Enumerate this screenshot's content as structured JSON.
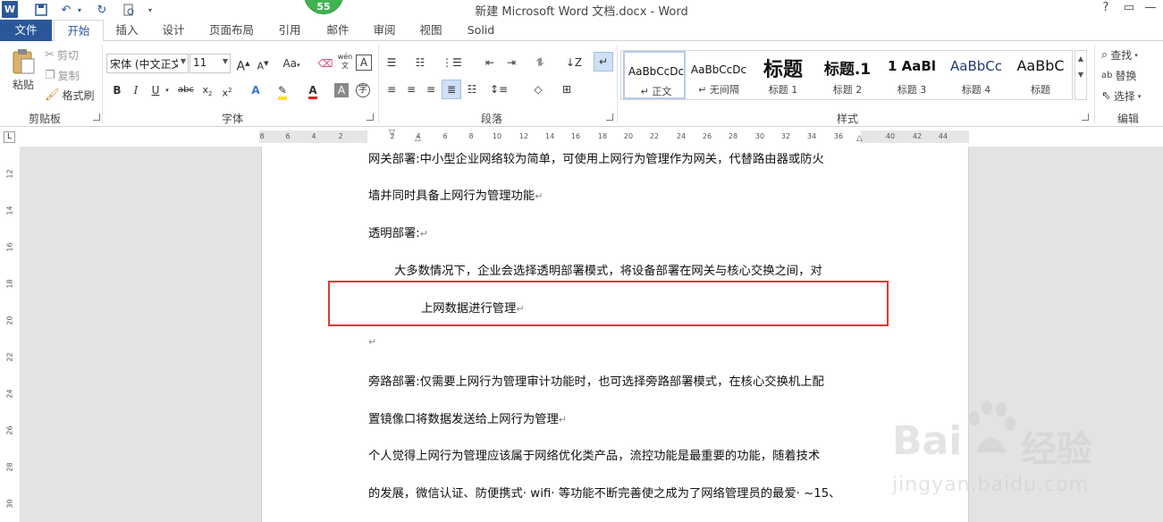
{
  "titlebar": {
    "title": "新建 Microsoft Word 文档.docx - Word",
    "badge": "55",
    "help": "?",
    "restore_glyph": "▭",
    "minimize_glyph": "—"
  },
  "tabs": [
    "文件",
    "开始",
    "插入",
    "设计",
    "页面布局",
    "引用",
    "邮件",
    "审阅",
    "视图",
    "Solid"
  ],
  "ribbon": {
    "clipboard": {
      "paste": "粘贴",
      "cut": "剪切",
      "copy": "复制",
      "format_painter": "格式刷",
      "label": "剪贴板"
    },
    "font": {
      "family": "宋体 (中文正文)",
      "size": "11",
      "label": "字体",
      "case_btn": "Aa",
      "wen": "wén",
      "A_box": "A"
    },
    "paragraph": {
      "label": "段落"
    },
    "styles": {
      "label": "样式",
      "items": [
        {
          "preview": "AaBbCcDc",
          "name": "正文",
          "pmark": "↵"
        },
        {
          "preview": "AaBbCcDc",
          "name": "无间隔",
          "pmark": "↵"
        },
        {
          "preview": "标题",
          "name": "标题 1"
        },
        {
          "preview": "标题.1",
          "name": "标题 2"
        },
        {
          "preview": "1 AaBl",
          "name": "标题 3"
        },
        {
          "preview": "AaBbCc",
          "name": "标题 4"
        },
        {
          "preview": "AaBbC",
          "name": "标题"
        }
      ]
    },
    "editing": {
      "find": "查找",
      "replace": "替换",
      "select": "选择",
      "label": "编辑"
    }
  },
  "ruler": {
    "h_ticks": [
      "8",
      "6",
      "4",
      "2",
      "2",
      "4",
      "6",
      "8",
      "10",
      "12",
      "14",
      "16",
      "18",
      "20",
      "22",
      "24",
      "26",
      "28",
      "30",
      "32",
      "34",
      "36",
      "40",
      "42",
      "44"
    ],
    "v_ticks": [
      "12",
      "14",
      "16",
      "18",
      "20",
      "22",
      "24",
      "26",
      "28",
      "30"
    ]
  },
  "document": {
    "lines": [
      "网关部署:中小型企业网络较为简单，可使用上网行为管理作为网关，代替路由器或防火",
      "墙并同时具备上网行为管理功能",
      "透明部署:",
      "大多数情况下，企业会选择透明部署模式，将设备部署在网关与核心交换之间，对",
      "上网数据进行管理",
      "",
      "旁路部署:仅需要上网行为管理审计功能时，也可选择旁路部署模式，在核心交换机上配",
      "置镜像口将数据发送给上网行为管理",
      "个人觉得上网行为管理应该属于网络优化类产品，流控功能是最重要的功能，随着技术",
      "的发展，微信认证、防便携式· wifi· 等功能不断完善使之成为了网络管理员的最爱· ~15、"
    ],
    "para_mark": "↵"
  },
  "watermark": {
    "brand": "Bai",
    "brand2": "经验",
    "url": "jingyan.baidu.com"
  }
}
